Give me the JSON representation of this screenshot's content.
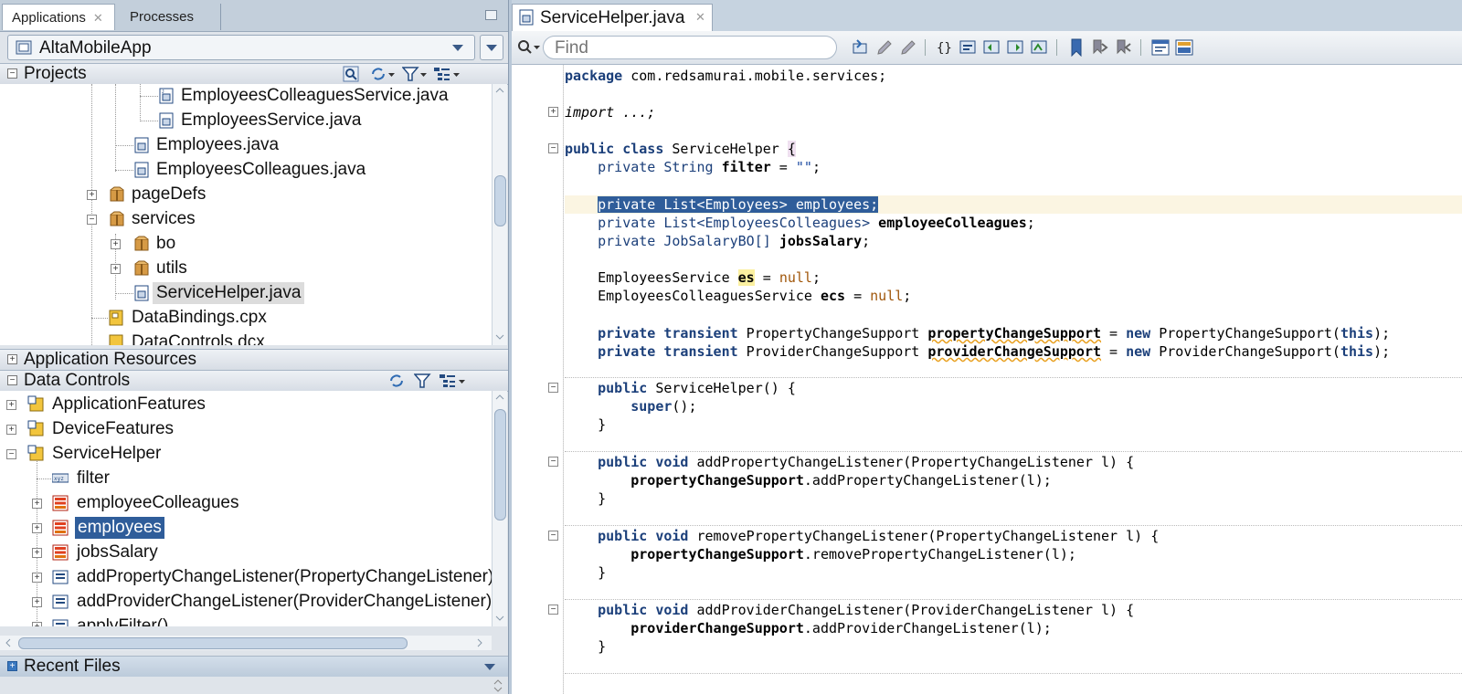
{
  "left_tabs": [
    "Applications",
    "Processes"
  ],
  "app_selector": {
    "value": "AltaMobileApp"
  },
  "sections": {
    "projects": "Projects",
    "app_resources": "Application Resources",
    "data_controls": "Data Controls",
    "recent_files": "Recent Files"
  },
  "project_tree": [
    "EmployeesColleaguesService.java",
    "EmployeesService.java",
    "Employees.java",
    "EmployeesColleagues.java",
    "pageDefs",
    "services",
    "bo",
    "utils",
    "ServiceHelper.java",
    "DataBindings.cpx",
    "DataControls.dcx"
  ],
  "data_controls_tree": [
    "ApplicationFeatures",
    "DeviceFeatures",
    "ServiceHelper",
    "filter",
    "employeeColleagues",
    "employees",
    "jobsSalary",
    "addPropertyChangeListener(PropertyChangeListener)",
    "addProviderChangeListener(ProviderChangeListener)",
    "applyFilter()"
  ],
  "editor": {
    "tab_title": "ServiceHelper.java",
    "find_placeholder": "Find"
  },
  "code": {
    "package_kw": "package",
    "package_name": " com.redsamurai.mobile.services;",
    "import_line": "import ...;",
    "class_decl_kw": "public class",
    "class_name": " ServiceHelper ",
    "brace_open": "{",
    "filter_decl_a": "    private String ",
    "filter_name": "filter",
    "filter_decl_b": " = ",
    "filter_value": "\"\"",
    "semi": ";",
    "employees_line": "private List<Employees> employees;",
    "colleagues_a": "    private List<EmployeesColleagues> ",
    "colleagues_name": "employeeColleagues",
    "jobs_a": "    private JobSalaryBO[] ",
    "jobs_name": "jobsSalary",
    "es_a": "    EmployeesService ",
    "es_name": "es",
    "ecs_a": "    EmployeesColleaguesService ",
    "ecs_name": "ecs",
    "assign": " = ",
    "null_kw": "null",
    "pcs_a": "    private transient",
    "pcs_b": " PropertyChangeSupport ",
    "pcs_name": "propertyChangeSupport",
    "pcs_c": " = ",
    "new_kw": "new",
    "pcs_d": " PropertyChangeSupport(",
    "this_kw": "this",
    "close_paren": ");",
    "prv_b": " ProviderChangeSupport ",
    "prv_name": "providerChangeSupport",
    "prv_d": " ProviderChangeSupport(",
    "ctor_kw": "    public",
    "ctor_rest": " ServiceHelper() {",
    "super_kw": "        super",
    "super_rest": "();",
    "close_brace": "    }",
    "m1_kw": "    public void",
    "m1_rest": " addPropertyChangeListener(PropertyChangeListener l) {",
    "m1_body_name": "        propertyChangeSupport",
    "m1_body_rest": ".addPropertyChangeListener(l);",
    "m2_rest": " removePropertyChangeListener(PropertyChangeListener l) {",
    "m2_body_rest": ".removePropertyChangeListener(l);",
    "m3_rest": " addProviderChangeListener(ProviderChangeListener l) {",
    "m3_body_name": "        providerChangeSupport",
    "m3_body_rest": ".addProviderChangeListener(l);"
  },
  "colors": {
    "selection": "#2f5d9a",
    "keyword": "#1b3f7a",
    "null": "#a0560a"
  }
}
